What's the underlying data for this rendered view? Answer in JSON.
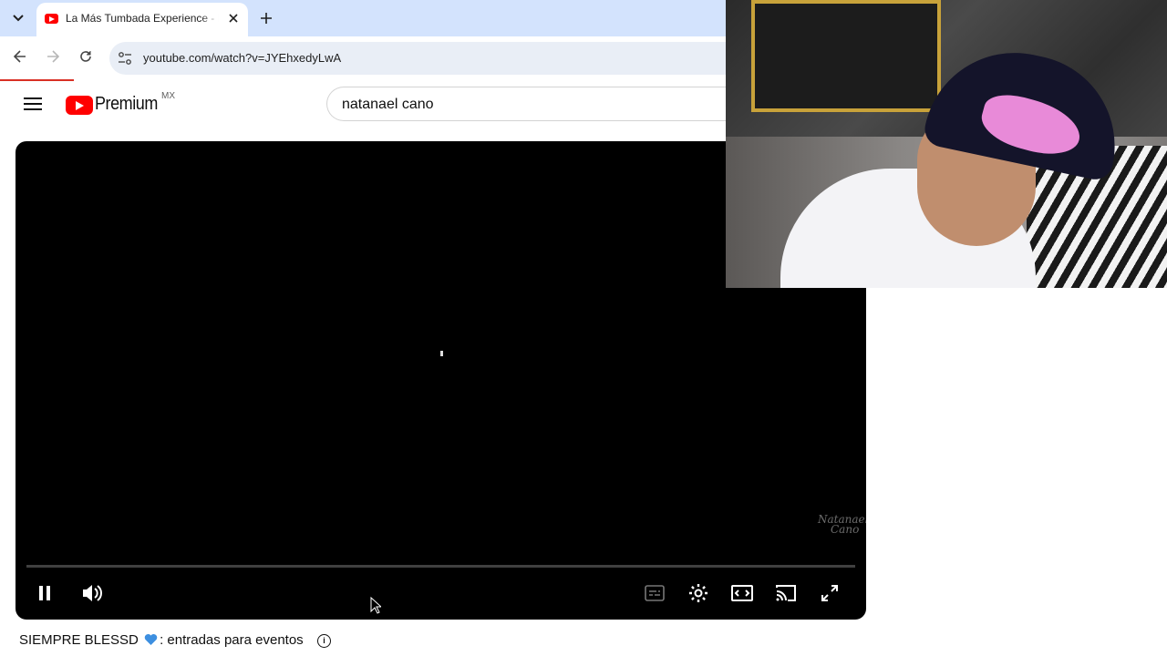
{
  "browser": {
    "tab": {
      "title": "La Más Tumbada Experience - N"
    },
    "address": {
      "url": "youtube.com/watch?v=JYEhxedyLwA"
    },
    "icons": {
      "tab_search": "chevron-down-icon",
      "close": "close-icon",
      "new_tab": "plus-icon",
      "back": "back-arrow-icon",
      "forward": "forward-arrow-icon",
      "reload": "reload-icon",
      "site_info": "tune-icon"
    },
    "colors": {
      "tabstrip": "#d3e3fd",
      "omnibox": "#e9eef6"
    }
  },
  "youtube": {
    "brand": "Premium",
    "region": "MX",
    "search": {
      "query": "natanael cano"
    },
    "colors": {
      "brand_red": "#ff0000"
    }
  },
  "player": {
    "watermark_line1": "Natanael",
    "watermark_line2": "Cano",
    "progress": 0.0,
    "controls": [
      "pause-icon",
      "volume-icon",
      "subtitles-icon",
      "settings-icon",
      "theater-mode-icon",
      "cast-icon",
      "fullscreen-icon"
    ]
  },
  "below": {
    "text_before": "SIEMPRE BLESSD",
    "text_after": ": entradas para eventos",
    "info_symbol": "i"
  }
}
